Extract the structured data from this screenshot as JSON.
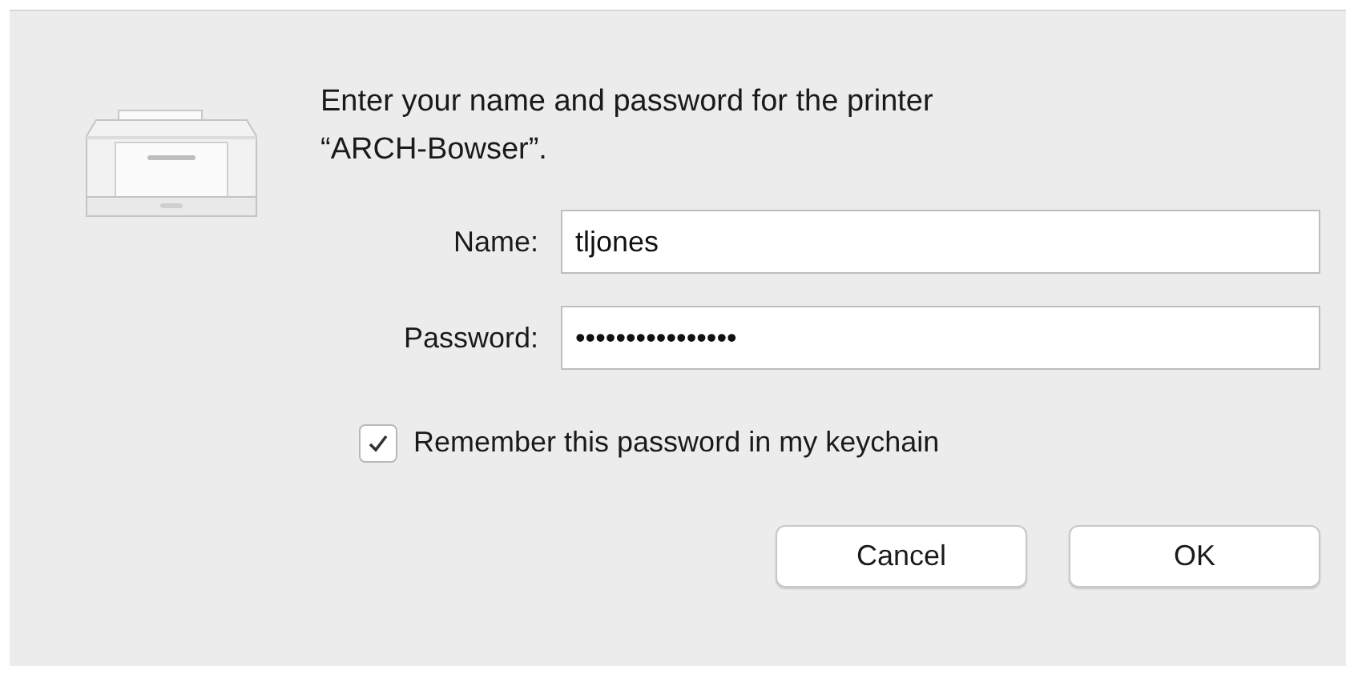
{
  "message": "Enter your name and password for the printer “ARCH-Bowser”.",
  "fields": [
    {
      "label": "Name:",
      "value": "tljones"
    },
    {
      "label": "Password:",
      "value": "••••••••••••••••"
    }
  ],
  "remember": {
    "label": "Remember this password in my keychain",
    "checked": true
  },
  "buttons": [
    {
      "label": "Cancel"
    },
    {
      "label": "OK"
    }
  ]
}
